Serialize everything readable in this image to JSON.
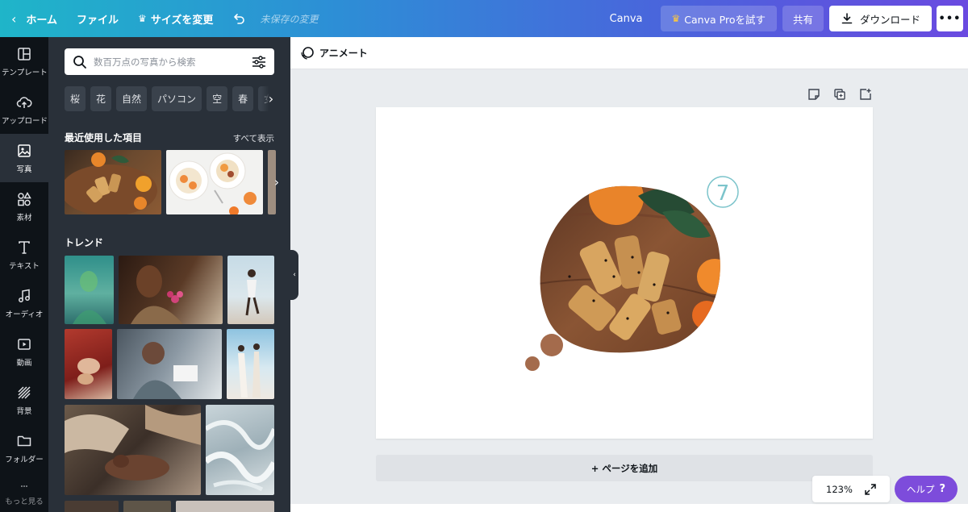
{
  "topbar": {
    "home": "ホーム",
    "file": "ファイル",
    "resize": "サイズを変更",
    "unsaved": "未保存の変更",
    "brand": "Canva",
    "pro": "Canva Proを試す",
    "share": "共有",
    "download": "ダウンロード",
    "more": "•••"
  },
  "rail": {
    "items": [
      {
        "label": "テンプレート",
        "icon": "layout-icon"
      },
      {
        "label": "アップロード",
        "icon": "cloud-upload-icon"
      },
      {
        "label": "写真",
        "icon": "photo-icon"
      },
      {
        "label": "素材",
        "icon": "shapes-icon"
      },
      {
        "label": "テキスト",
        "icon": "text-icon"
      },
      {
        "label": "オーディオ",
        "icon": "music-icon"
      },
      {
        "label": "動画",
        "icon": "video-icon"
      },
      {
        "label": "背景",
        "icon": "background-icon"
      },
      {
        "label": "フォルダー",
        "icon": "folder-icon"
      },
      {
        "label": "もっと見る",
        "icon": "more-icon"
      }
    ]
  },
  "panel": {
    "search_placeholder": "数百万点の写真から検索",
    "chips": [
      "桜",
      "花",
      "自然",
      "パソコン",
      "空",
      "春",
      "女"
    ],
    "recent_title": "最近使用した項目",
    "see_all": "すべて表示",
    "trend_title": "トレンド"
  },
  "editor": {
    "animate": "アニメート",
    "add_page": "+ ページを追加",
    "zoom": "123%",
    "help": "ヘルプ",
    "help_q": "?",
    "badge_number": "7"
  },
  "colors": {
    "accent_purple": "#7d4cdb",
    "badge_teal": "#7cc4cb",
    "bubble_brown": "#a46b4c"
  }
}
